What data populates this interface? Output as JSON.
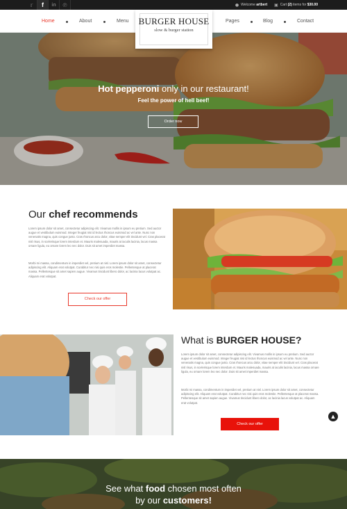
{
  "topbar": {
    "social": [
      "twitter-icon",
      "facebook-icon",
      "linkedin-icon",
      "pinterest-icon"
    ],
    "welcome_prefix": "Welcome",
    "welcome_user": "artbert",
    "cart_prefix": "Cart",
    "cart_count": "(2)",
    "cart_mid": "items for",
    "cart_total": "$30.00"
  },
  "nav": {
    "items": [
      "Home",
      "About",
      "Menu",
      "Pages",
      "Blog",
      "Contact"
    ],
    "active": "Home"
  },
  "logo": {
    "title": "BURGER HOUSE",
    "subtitle": "slow & burger station"
  },
  "hero": {
    "headline_bold": "Hot pepperoni",
    "headline_rest": " only in our restaurant!",
    "subheadline": "Feel the power of hell beef!",
    "button": "Order now"
  },
  "recommend": {
    "heading_light": "Our ",
    "heading_bold": "chef recommends",
    "para1": "Lorem ipsum dolor sit amet, consectetur adipiscing elit. Vivamus mollis in ipsum eu pretium. Sed auctor augue et vestibulum euismod. Integer feugiat nisi id lectus rhoncus euismod ac vel ante. Nunc non venenatis magna, quis congue justo. Cras rhoncus arcu dolor, vitae semper elit tincidunt vel. Cras placerat nisl risus, in scelerisque lorem interdum et. Mauris malesuada, mauris at iaculis lacinia, lacus massa ornare ligula, eu ornare lorem leo nec dolor. Duis sit amet imperdiet massa.",
    "para2": "Morbi mi massa, condimentum in imperdiet vel, pretium at nisl. Lorem ipsum dolor sit amet, consectetur adipiscing elit. Aliquam erat volutpat. Curabitur nec nisi quis eros molestie. Pellentesque at placerat massa. Pellentesque sit amet sapien augue. Vivamus tincidunt libero dolor, ac lacinia lacus volutpat ac. Aliquam erat volutpat.",
    "button": "Check our offer"
  },
  "what": {
    "heading_light": "What is ",
    "heading_bold": "BURGER HOUSE?",
    "para1": "Lorem ipsum dolor sit amet, consectetur adipiscing elit. Vivamus mollis in ipsum eu pretium. Sed auctor augue et vestibulum euismod. Integer feugiat nisi id lectus rhoncus euismod ac vel ante. Nunc non venenatis magna, quis congue justo. Cras rhoncus arcu dolor, vitae semper elit tincidunt vel. Cras placerat nisl risus, in scelerisque lorem interdum et. Mauris malesuada, mauris at iaculis lacinia, lacus massa ornare ligula, eu ornare lorem leo nec dolor. Duis sit amet imperdiet massa.",
    "para2": "Morbi mi massa, condimentum in imperdiet vel, pretium at nisl. Lorem ipsum dolor sit amet, consectetur adipiscing elit. Aliquam erat volutpat. Curabitur nec nisi quis eros molestie. Pellentesque at placerat massa. Pellentesque sit amet sapien augue. Vivamus tincidunt libero dolor, ac lacinia lacus volutpat ac. Aliquam erat volutpat.",
    "button": "Check our offer"
  },
  "bottom": {
    "line1_a": "See what ",
    "line1_bold": "food",
    "line1_b": " chosen most often",
    "line2_a": "by our ",
    "line2_bold": "customers!"
  },
  "colors": {
    "accent": "#e8372a",
    "button_red": "#e8120a",
    "topbar": "#1c1c1c"
  },
  "icons": {
    "user": "user-icon",
    "cart": "cart-icon",
    "scroll_top": "chevron-up-icon"
  }
}
